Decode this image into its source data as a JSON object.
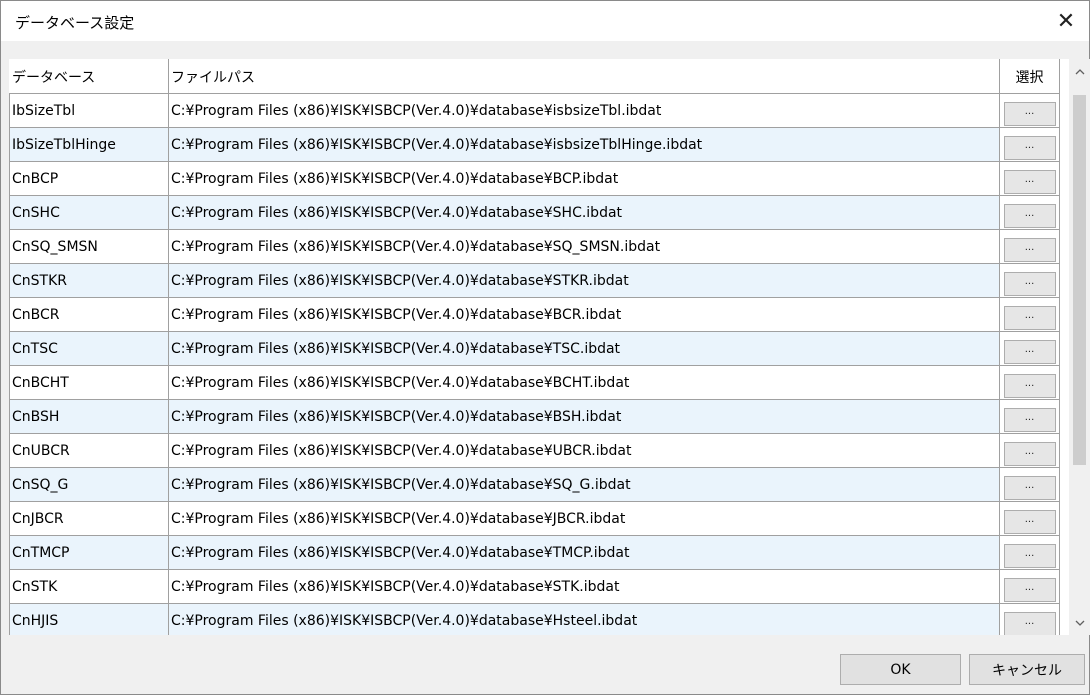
{
  "window": {
    "title": "データベース設定",
    "close_glyph": "✕"
  },
  "grid": {
    "columns": [
      "データベース",
      "ファイルパス",
      "選択"
    ],
    "rows": [
      {
        "name": "IbSizeTbl",
        "path": "C:¥Program Files (x86)¥ISK¥ISBCP(Ver.4.0)¥database¥isbsizeTbl.ibdat"
      },
      {
        "name": "IbSizeTblHinge",
        "path": "C:¥Program Files (x86)¥ISK¥ISBCP(Ver.4.0)¥database¥isbsizeTblHinge.ibdat"
      },
      {
        "name": "CnBCP",
        "path": "C:¥Program Files (x86)¥ISK¥ISBCP(Ver.4.0)¥database¥BCP.ibdat"
      },
      {
        "name": "CnSHC",
        "path": "C:¥Program Files (x86)¥ISK¥ISBCP(Ver.4.0)¥database¥SHC.ibdat"
      },
      {
        "name": "CnSQ_SMSN",
        "path": "C:¥Program Files (x86)¥ISK¥ISBCP(Ver.4.0)¥database¥SQ_SMSN.ibdat"
      },
      {
        "name": "CnSTKR",
        "path": "C:¥Program Files (x86)¥ISK¥ISBCP(Ver.4.0)¥database¥STKR.ibdat"
      },
      {
        "name": "CnBCR",
        "path": "C:¥Program Files (x86)¥ISK¥ISBCP(Ver.4.0)¥database¥BCR.ibdat"
      },
      {
        "name": "CnTSC",
        "path": "C:¥Program Files (x86)¥ISK¥ISBCP(Ver.4.0)¥database¥TSC.ibdat"
      },
      {
        "name": "CnBCHT",
        "path": "C:¥Program Files (x86)¥ISK¥ISBCP(Ver.4.0)¥database¥BCHT.ibdat"
      },
      {
        "name": "CnBSH",
        "path": "C:¥Program Files (x86)¥ISK¥ISBCP(Ver.4.0)¥database¥BSH.ibdat"
      },
      {
        "name": "CnUBCR",
        "path": "C:¥Program Files (x86)¥ISK¥ISBCP(Ver.4.0)¥database¥UBCR.ibdat"
      },
      {
        "name": "CnSQ_G",
        "path": "C:¥Program Files (x86)¥ISK¥ISBCP(Ver.4.0)¥database¥SQ_G.ibdat"
      },
      {
        "name": "CnJBCR",
        "path": "C:¥Program Files (x86)¥ISK¥ISBCP(Ver.4.0)¥database¥JBCR.ibdat"
      },
      {
        "name": "CnTMCP",
        "path": "C:¥Program Files (x86)¥ISK¥ISBCP(Ver.4.0)¥database¥TMCP.ibdat"
      },
      {
        "name": "CnSTK",
        "path": "C:¥Program Files (x86)¥ISK¥ISBCP(Ver.4.0)¥database¥STK.ibdat"
      },
      {
        "name": "CnHJIS",
        "path": "C:¥Program Files (x86)¥ISK¥ISBCP(Ver.4.0)¥database¥Hsteel.ibdat"
      },
      {
        "name": "",
        "path": ""
      }
    ],
    "select_button_label": "...",
    "alt_row_color": "#eaf4fc"
  },
  "scrollbar": {
    "up_glyph": "^",
    "down_glyph": "v"
  },
  "buttons": {
    "ok_label": "OK",
    "cancel_label": "キャンセル"
  }
}
